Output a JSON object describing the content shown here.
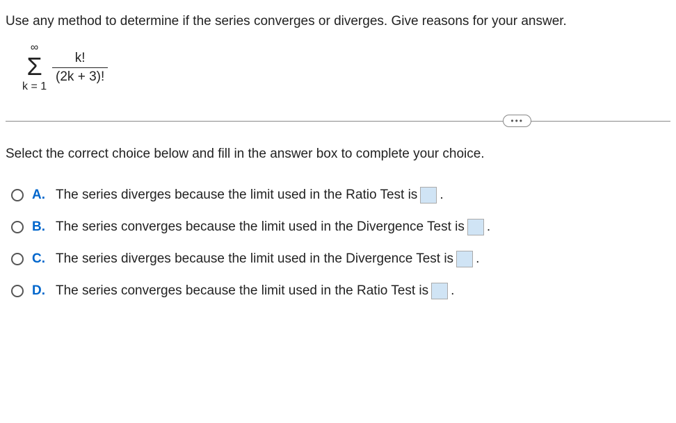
{
  "question": "Use any method to determine if the series converges or diverges. Give reasons for your answer.",
  "formula": {
    "sigma_top": "∞",
    "sigma": "Σ",
    "sigma_bottom": "k = 1",
    "numerator": "k!",
    "denominator": "(2k + 3)!"
  },
  "instruction": "Select the correct choice below and fill in the answer box to complete your choice.",
  "choices": {
    "a": {
      "letter": "A.",
      "text_before": "The series diverges because the limit used in the Ratio Test is",
      "text_after": "."
    },
    "b": {
      "letter": "B.",
      "text_before": "The series converges because the limit used in the Divergence Test is",
      "text_after": "."
    },
    "c": {
      "letter": "C.",
      "text_before": "The series diverges because the limit used in the Divergence Test is",
      "text_after": "."
    },
    "d": {
      "letter": "D.",
      "text_before": "The series converges because the limit used in the Ratio Test is",
      "text_after": "."
    }
  }
}
